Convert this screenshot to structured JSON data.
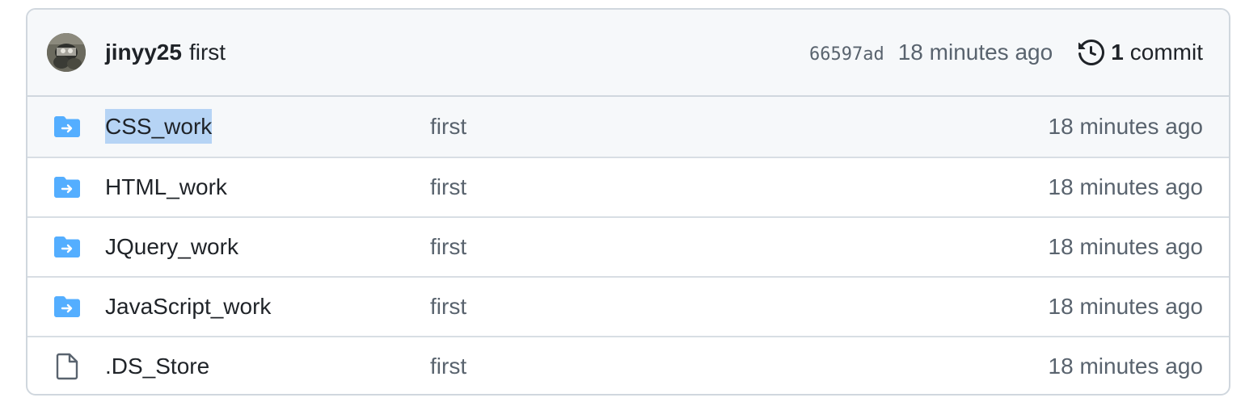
{
  "commit": {
    "author": "jinyy25",
    "message": "first",
    "sha": "66597ad",
    "time": "18 minutes ago",
    "commit_count": "1",
    "commit_label": "commit"
  },
  "files": [
    {
      "name": "CSS_work",
      "type": "folder",
      "message": "first",
      "time": "18 minutes ago",
      "selected": true
    },
    {
      "name": "HTML_work",
      "type": "folder",
      "message": "first",
      "time": "18 minutes ago"
    },
    {
      "name": "JQuery_work",
      "type": "folder",
      "message": "first",
      "time": "18 minutes ago"
    },
    {
      "name": "JavaScript_work",
      "type": "folder",
      "message": "first",
      "time": "18 minutes ago"
    },
    {
      "name": ".DS_Store",
      "type": "file",
      "message": "first",
      "time": "18 minutes ago"
    }
  ],
  "colors": {
    "folder": "#54aeff",
    "file_icon": "#59636e",
    "selection": "#b6d4f5",
    "header_bg": "#f6f8fa",
    "border": "#d0d7de"
  },
  "icons": {
    "avatar": "avatar",
    "history": "history-icon",
    "folder": "file-directory-symlink-icon",
    "file": "file-icon"
  }
}
